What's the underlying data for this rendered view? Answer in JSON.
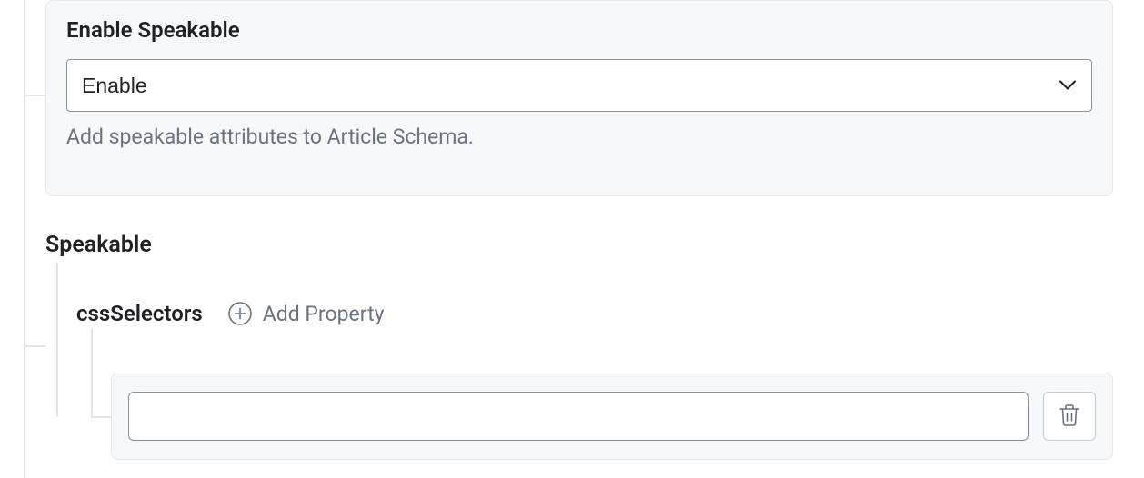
{
  "panel": {
    "label": "Enable Speakable",
    "select_value": "Enable",
    "helper": "Add speakable attributes to Article Schema."
  },
  "speakable": {
    "heading": "Speakable",
    "css_label": "cssSelectors",
    "add_property": "Add Property",
    "input_value": ""
  }
}
